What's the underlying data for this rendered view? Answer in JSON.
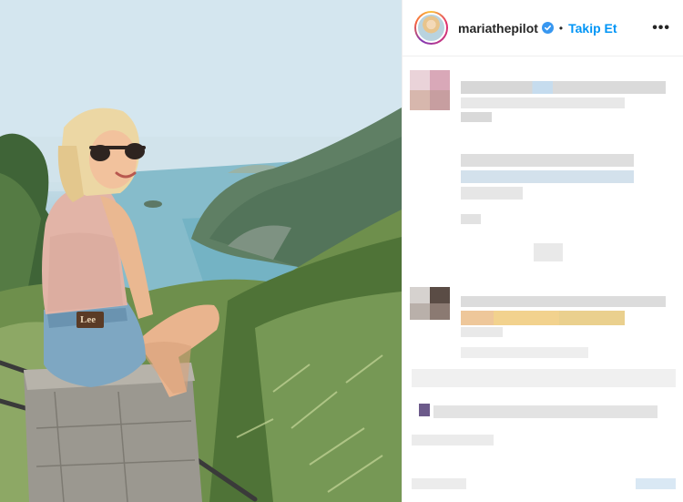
{
  "post": {
    "username": "mariathepilot",
    "separator": "•",
    "follow_label": "Takip Et",
    "more_label": "•••",
    "verified": true
  },
  "photo": {
    "brand_patch_text": "Lee"
  },
  "icons": {
    "verified": "verified-badge-icon",
    "more": "more-options-icon"
  },
  "colors": {
    "follow_blue": "#0095f6",
    "verified_blue": "#3897f0",
    "text_dark": "#262626"
  }
}
